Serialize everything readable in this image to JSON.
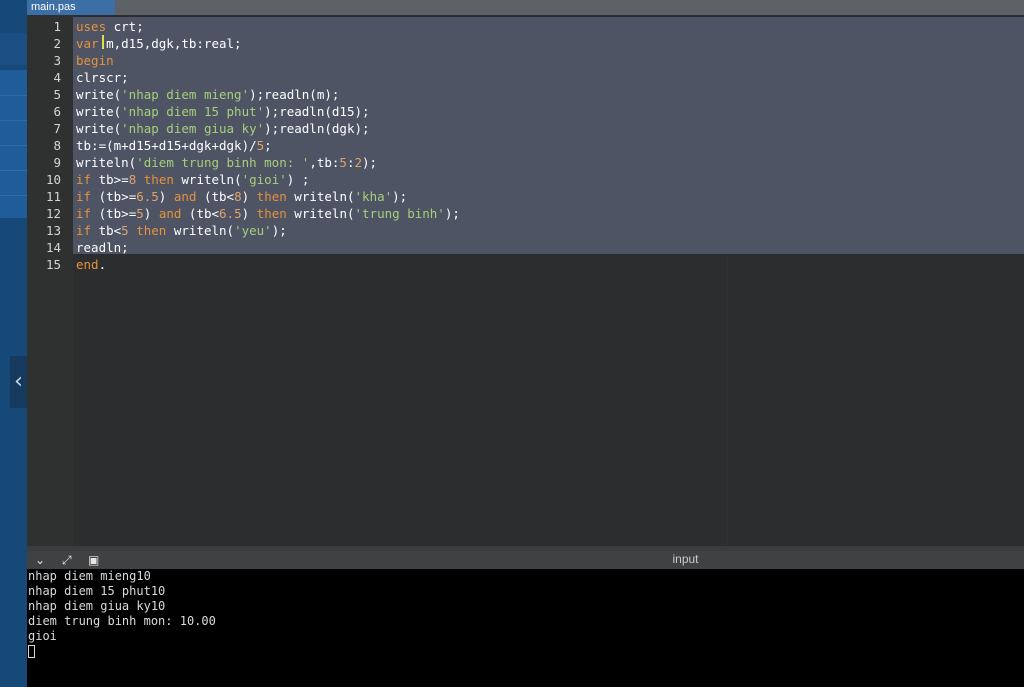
{
  "tab": {
    "title": "main.pas"
  },
  "editor": {
    "lines": [
      {
        "n": "1",
        "seg": [
          [
            "kw",
            "uses"
          ],
          [
            "pl",
            " crt;"
          ]
        ]
      },
      {
        "n": "2",
        "seg": [
          [
            "kw",
            "var"
          ],
          [
            "pl",
            " m,d15,dgk,tb:real;"
          ]
        ]
      },
      {
        "n": "3",
        "seg": [
          [
            "kw",
            "begin"
          ]
        ]
      },
      {
        "n": "4",
        "seg": [
          [
            "pl",
            "clrscr;"
          ]
        ]
      },
      {
        "n": "5",
        "seg": [
          [
            "pl",
            "write("
          ],
          [
            "str",
            "'nhap diem mieng'"
          ],
          [
            "pl",
            ");readln(m);"
          ]
        ]
      },
      {
        "n": "6",
        "seg": [
          [
            "pl",
            "write("
          ],
          [
            "str",
            "'nhap diem 15 phut'"
          ],
          [
            "pl",
            ");readln(d15);"
          ]
        ]
      },
      {
        "n": "7",
        "seg": [
          [
            "pl",
            "write("
          ],
          [
            "str",
            "'nhap diem giua ky'"
          ],
          [
            "pl",
            ");readln(dgk);"
          ]
        ]
      },
      {
        "n": "8",
        "seg": [
          [
            "pl",
            "tb:=(m+d15+d15+dgk+dgk)/"
          ],
          [
            "nm",
            "5"
          ],
          [
            "pl",
            ";"
          ]
        ]
      },
      {
        "n": "9",
        "seg": [
          [
            "pl",
            "writeln("
          ],
          [
            "str",
            "'diem trung binh mon: '"
          ],
          [
            "pl",
            ",tb:"
          ],
          [
            "nm",
            "5"
          ],
          [
            "pl",
            ":"
          ],
          [
            "nm",
            "2"
          ],
          [
            "pl",
            ");"
          ]
        ]
      },
      {
        "n": "10",
        "seg": [
          [
            "kw",
            "if"
          ],
          [
            "pl",
            " tb>="
          ],
          [
            "nm",
            "8"
          ],
          [
            "pl",
            " "
          ],
          [
            "kw",
            "then"
          ],
          [
            "pl",
            " writeln("
          ],
          [
            "str",
            "'gioi'"
          ],
          [
            "pl",
            ") ;"
          ]
        ]
      },
      {
        "n": "11",
        "seg": [
          [
            "kw",
            "if"
          ],
          [
            "pl",
            " (tb>="
          ],
          [
            "nm",
            "6.5"
          ],
          [
            "pl",
            ") "
          ],
          [
            "kw",
            "and"
          ],
          [
            "pl",
            " (tb<"
          ],
          [
            "nm",
            "8"
          ],
          [
            "pl",
            ") "
          ],
          [
            "kw",
            "then"
          ],
          [
            "pl",
            " writeln("
          ],
          [
            "str",
            "'kha'"
          ],
          [
            "pl",
            ");"
          ]
        ]
      },
      {
        "n": "12",
        "seg": [
          [
            "kw",
            "if"
          ],
          [
            "pl",
            " (tb>="
          ],
          [
            "nm",
            "5"
          ],
          [
            "pl",
            ") "
          ],
          [
            "kw",
            "and"
          ],
          [
            "pl",
            " (tb<"
          ],
          [
            "nm",
            "6.5"
          ],
          [
            "pl",
            ") "
          ],
          [
            "kw",
            "then"
          ],
          [
            "pl",
            " writeln("
          ],
          [
            "str",
            "'trung binh'"
          ],
          [
            "pl",
            ");"
          ]
        ]
      },
      {
        "n": "13",
        "seg": [
          [
            "kw",
            "if"
          ],
          [
            "pl",
            " tb<"
          ],
          [
            "nm",
            "5"
          ],
          [
            "pl",
            " "
          ],
          [
            "kw",
            "then"
          ],
          [
            "pl",
            " writeln("
          ],
          [
            "str",
            "'yeu'"
          ],
          [
            "pl",
            ");"
          ]
        ]
      },
      {
        "n": "14",
        "seg": [
          [
            "pl",
            "readln;"
          ]
        ]
      },
      {
        "n": "15",
        "seg": [
          [
            "kw",
            "end"
          ],
          [
            "pl",
            "."
          ]
        ]
      }
    ]
  },
  "input_panel": {
    "title": "input",
    "icons": [
      "chevron-down-icon",
      "expand-icon",
      "clipboard-icon"
    ]
  },
  "console": {
    "lines": [
      "nhap diem mieng10",
      "nhap diem 15 phut10",
      "nhap diem giua ky10",
      "diem trung binh mon: 10.00",
      "gioi"
    ]
  },
  "colors": {
    "keyword": "#e5923c",
    "string": "#a6cf7a",
    "number": "#e0a26c",
    "selection": "#4e5464",
    "tab_bg": "#3b6fa6"
  }
}
